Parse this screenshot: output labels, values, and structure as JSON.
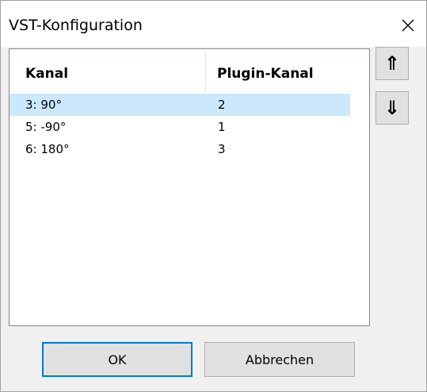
{
  "window": {
    "title": "VST-Konfiguration",
    "close_glyph": "✕"
  },
  "list": {
    "columns": [
      "Kanal",
      "Plugin-Kanal"
    ],
    "rows": [
      {
        "kanal": "3: 90°",
        "plugin_kanal": "2",
        "selected": true
      },
      {
        "kanal": "5: -90°",
        "plugin_kanal": "1",
        "selected": false
      },
      {
        "kanal": "6: 180°",
        "plugin_kanal": "3",
        "selected": false
      }
    ],
    "selection_color": "#cce8ff"
  },
  "side_buttons": {
    "up_glyph": "⇑",
    "up_icon": "double-arrow-up-icon",
    "down_glyph": "⇓",
    "down_icon": "double-arrow-down-icon"
  },
  "buttons": {
    "ok_label": "OK",
    "cancel_label": "Abbrechen"
  },
  "colors": {
    "accent": "#0078d7",
    "dialog_bg": "#f0f0f0",
    "button_bg": "#e1e1e1"
  }
}
